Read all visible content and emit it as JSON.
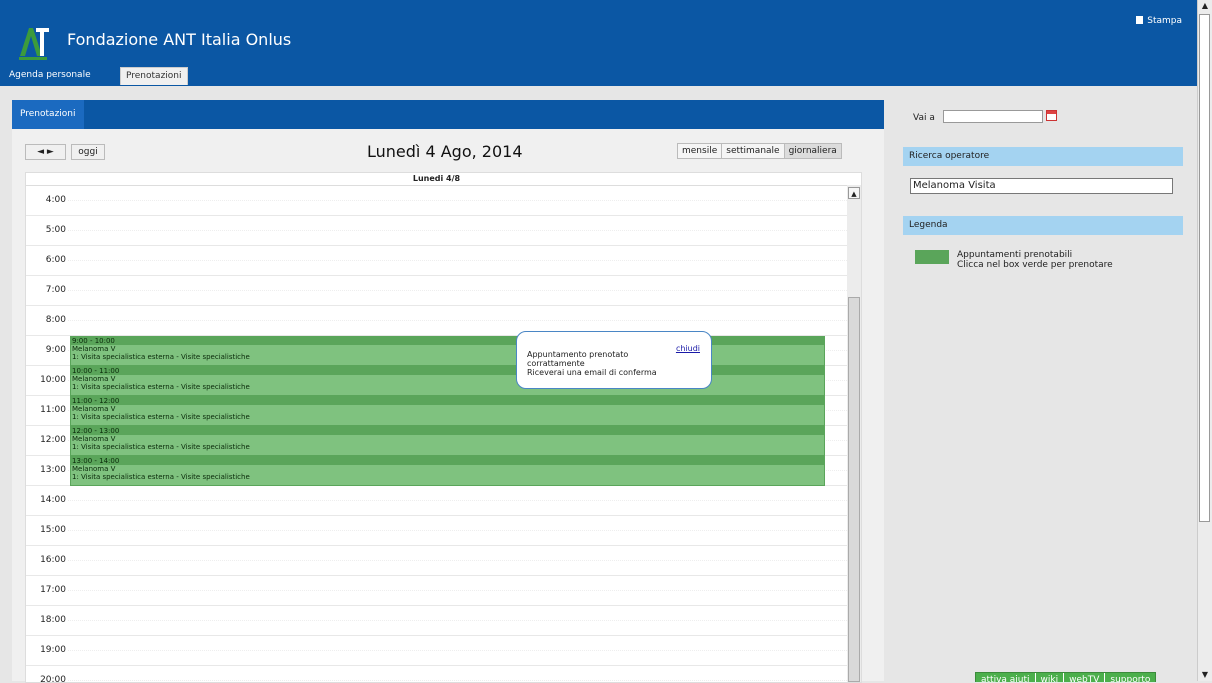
{
  "header": {
    "title": "Fondazione ANT Italia Onlus",
    "print_label": "Stampa",
    "tabs": [
      {
        "label": "Agenda personale"
      },
      {
        "label": "Prenotazioni"
      }
    ]
  },
  "main": {
    "tab_label": "Prenotazioni",
    "nav": {
      "prev_next": "◄ ►",
      "today": "oggi"
    },
    "date_title": "Lunedì 4 Ago, 2014",
    "views": [
      "mensile",
      "settimanale",
      "giornaliera"
    ],
    "day_header": "Lunedi 4/8",
    "hours": [
      "4:00",
      "5:00",
      "6:00",
      "7:00",
      "8:00",
      "9:00",
      "10:00",
      "11:00",
      "12:00",
      "13:00",
      "14:00",
      "15:00",
      "16:00",
      "17:00",
      "18:00",
      "19:00",
      "20:00"
    ],
    "events": [
      {
        "time": "9:00 - 10:00",
        "name": "Melanoma V",
        "desc": "1: Visita specialistica esterna - Visite specialistiche"
      },
      {
        "time": "10:00 - 11:00",
        "name": "Melanoma V",
        "desc": "1: Visita specialistica esterna - Visite specialistiche"
      },
      {
        "time": "11:00 - 12:00",
        "name": "Melanoma V",
        "desc": "1: Visita specialistica esterna - Visite specialistiche"
      },
      {
        "time": "12:00 - 13:00",
        "name": "Melanoma V",
        "desc": "1: Visita specialistica esterna - Visite specialistiche"
      },
      {
        "time": "13:00 - 14:00",
        "name": "Melanoma V",
        "desc": "1: Visita specialistica esterna - Visite specialistiche"
      }
    ]
  },
  "popup": {
    "line1": "Appuntamento prenotato",
    "line2": "corrattamente",
    "line3": "Riceverai una email di conferma",
    "close": "chiudi"
  },
  "sidebar": {
    "goto_label": "Vai a",
    "goto_value": "",
    "operator_search_title": "Ricerca operatore",
    "operator_value": "Melanoma Visita",
    "legend_title": "Legenda",
    "legend_line1": "Appuntamenti prenotabili",
    "legend_line2": "Clicca nel box verde per prenotare"
  },
  "footer_links": [
    "attiva aiuti",
    "wiki",
    "webTV",
    "supporto"
  ],
  "colors": {
    "header_blue": "#0b57a4",
    "event_green": "#7fc27f",
    "event_head": "#5aa55a",
    "side_head": "#a4d3f1"
  }
}
